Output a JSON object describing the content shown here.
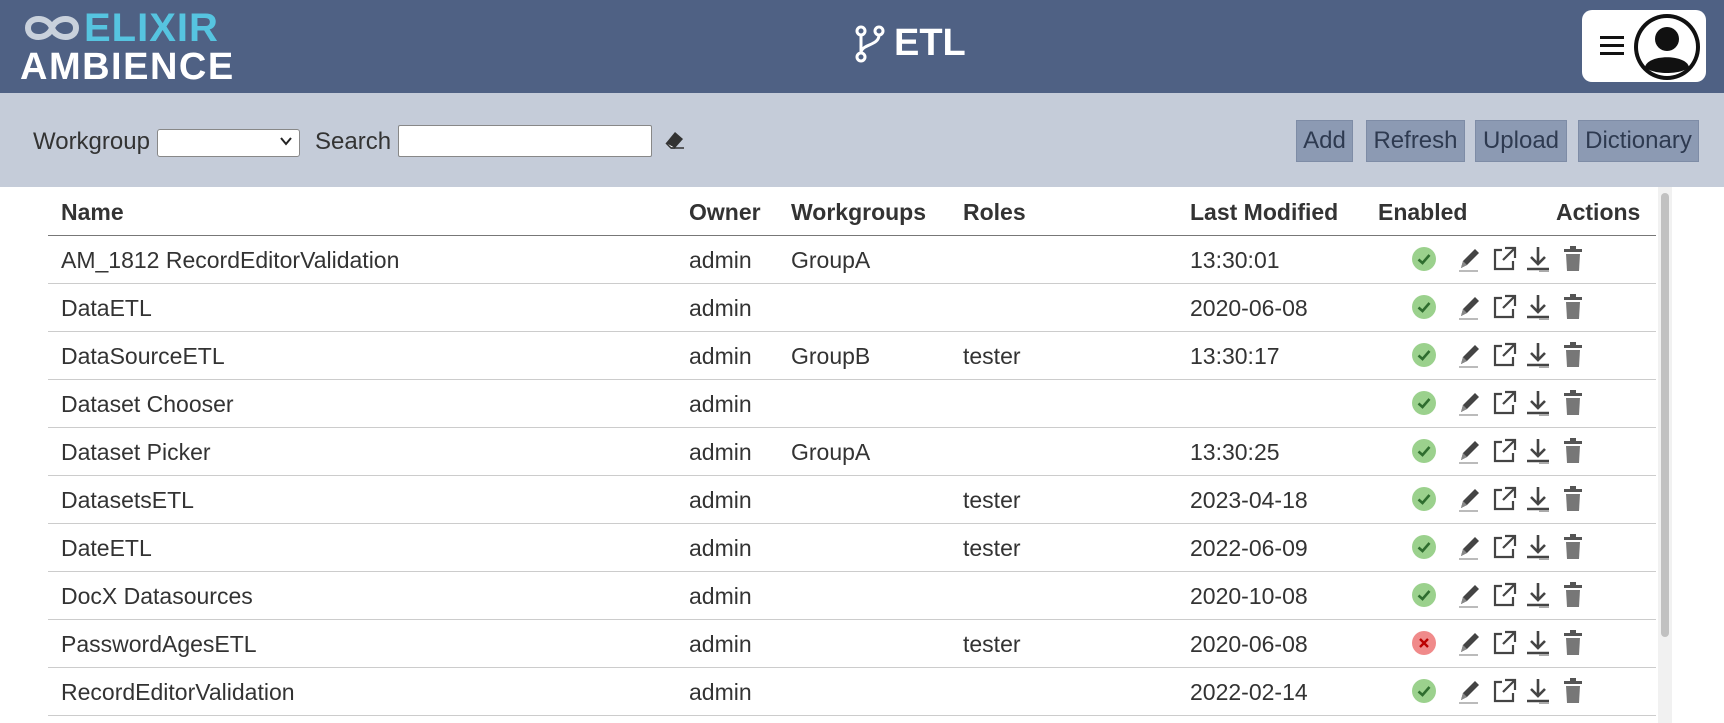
{
  "brand": {
    "line1": "ELIXIR",
    "line2": "AMBIENCE",
    "accent": "#56c4e0",
    "header_bg": "#4f6184"
  },
  "page": {
    "title": "ETL",
    "title_icon": "git-branch-icon"
  },
  "toolbar": {
    "workgroup_label": "Workgroup",
    "workgroup_value": "",
    "search_label": "Search",
    "search_value": "",
    "buttons": {
      "add": "Add",
      "refresh": "Refresh",
      "upload": "Upload",
      "dictionary": "Dictionary"
    }
  },
  "table": {
    "headers": {
      "name": "Name",
      "owner": "Owner",
      "workgroups": "Workgroups",
      "roles": "Roles",
      "modified": "Last Modified",
      "enabled": "Enabled",
      "actions": "Actions"
    },
    "rows": [
      {
        "name": "AM_1812 RecordEditorValidation",
        "owner": "admin",
        "workgroups": "GroupA",
        "roles": "",
        "modified": "13:30:01",
        "enabled": true
      },
      {
        "name": "DataETL",
        "owner": "admin",
        "workgroups": "",
        "roles": "",
        "modified": "2020-06-08",
        "enabled": true
      },
      {
        "name": "DataSourceETL",
        "owner": "admin",
        "workgroups": "GroupB",
        "roles": "tester",
        "modified": "13:30:17",
        "enabled": true
      },
      {
        "name": "Dataset Chooser",
        "owner": "admin",
        "workgroups": "",
        "roles": "",
        "modified": "",
        "enabled": true
      },
      {
        "name": "Dataset Picker",
        "owner": "admin",
        "workgroups": "GroupA",
        "roles": "",
        "modified": "13:30:25",
        "enabled": true
      },
      {
        "name": "DatasetsETL",
        "owner": "admin",
        "workgroups": "",
        "roles": "tester",
        "modified": "2023-04-18",
        "enabled": true
      },
      {
        "name": "DateETL",
        "owner": "admin",
        "workgroups": "",
        "roles": "tester",
        "modified": "2022-06-09",
        "enabled": true
      },
      {
        "name": "DocX Datasources",
        "owner": "admin",
        "workgroups": "",
        "roles": "",
        "modified": "2020-10-08",
        "enabled": true
      },
      {
        "name": "PasswordAgesETL",
        "owner": "admin",
        "workgroups": "",
        "roles": "tester",
        "modified": "2020-06-08",
        "enabled": false
      },
      {
        "name": "RecordEditorValidation",
        "owner": "admin",
        "workgroups": "",
        "roles": "",
        "modified": "2022-02-14",
        "enabled": true
      }
    ],
    "action_icons": [
      "pencil-icon",
      "external-link-icon",
      "download-icon",
      "trash-icon"
    ],
    "status_colors": {
      "enabled": "#9bd18d",
      "disabled": "#f08a8a"
    }
  }
}
